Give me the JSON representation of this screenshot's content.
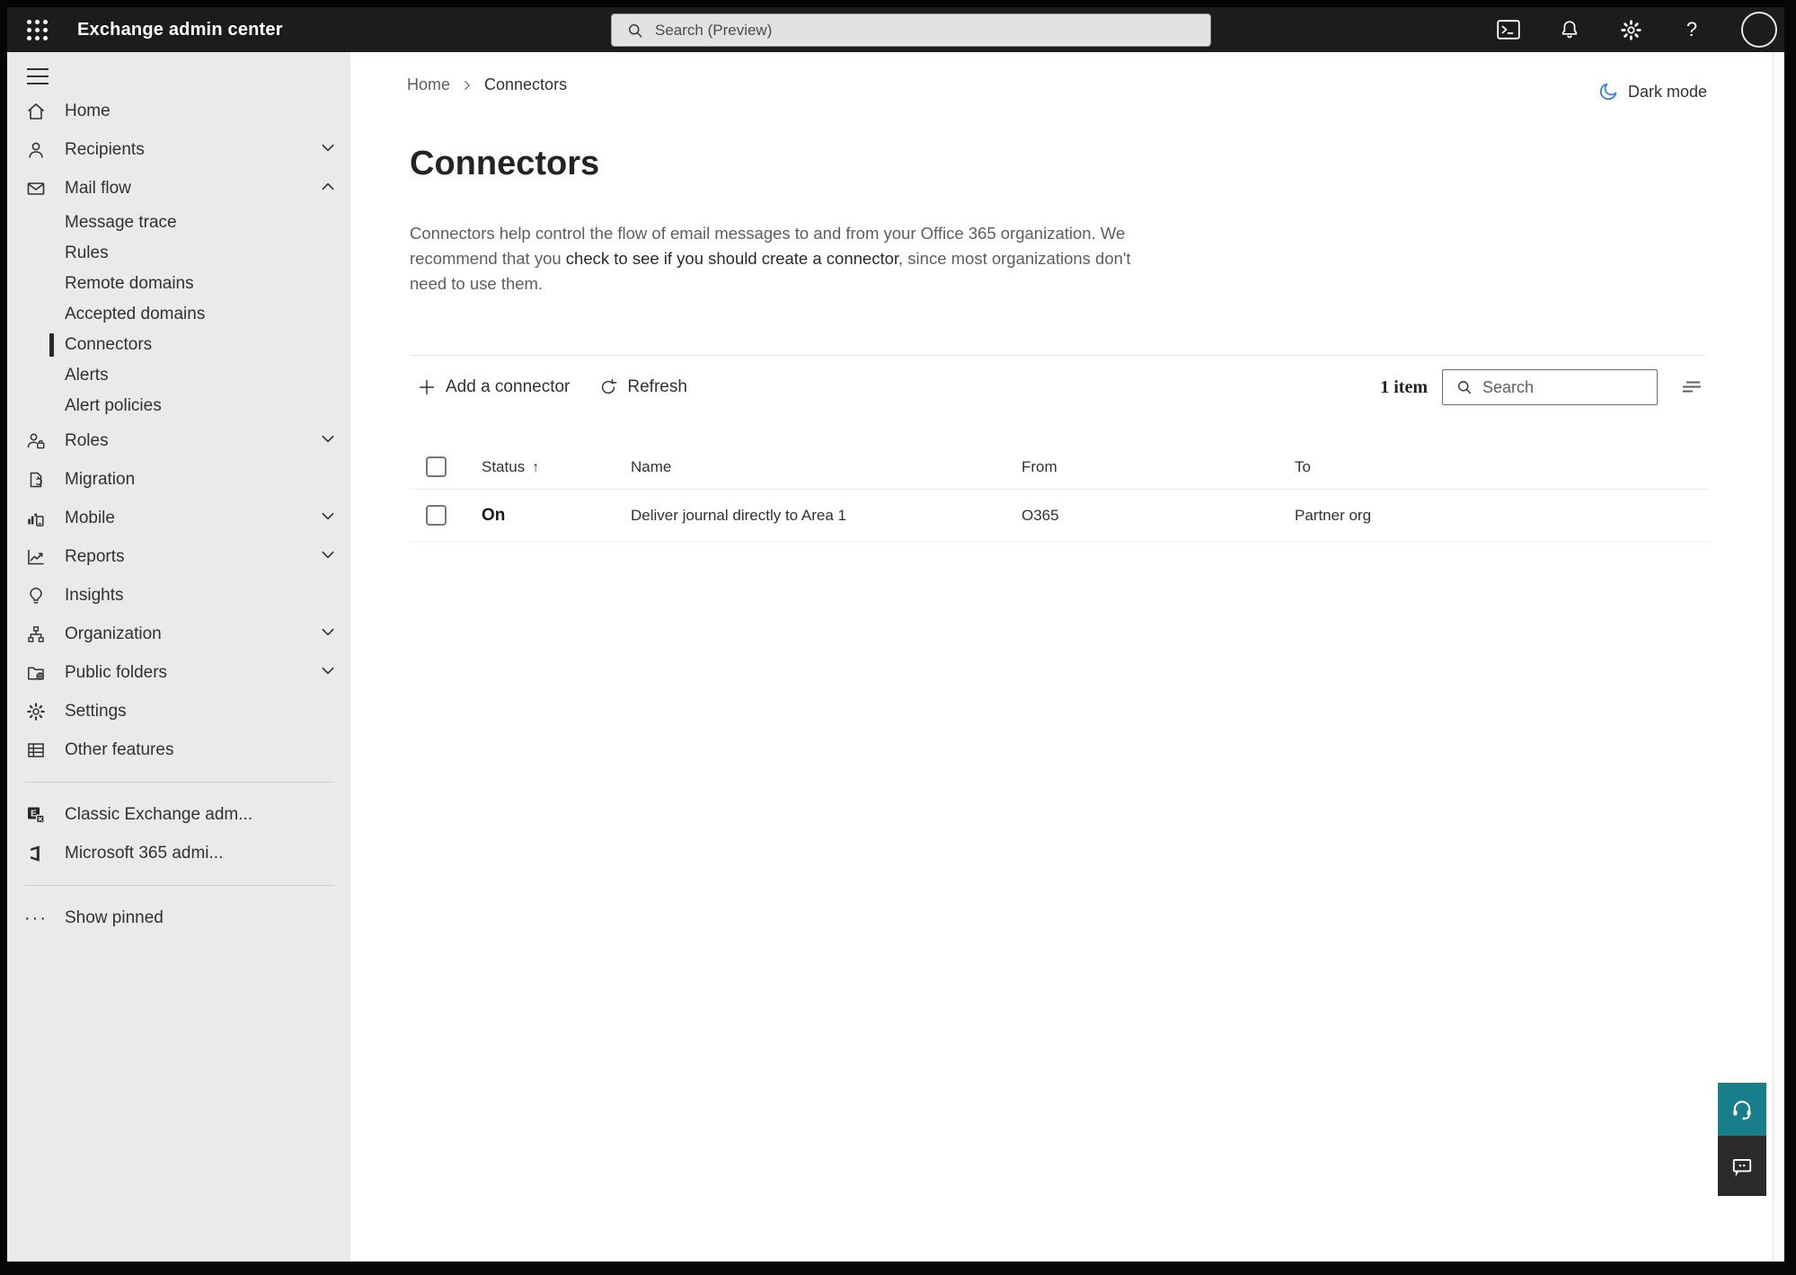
{
  "topbar": {
    "title": "Exchange admin center",
    "search_placeholder": "Search (Preview)"
  },
  "sidebar": {
    "items": [
      {
        "label": "Home"
      },
      {
        "label": "Recipients"
      },
      {
        "label": "Mail flow"
      },
      {
        "label": "Message trace"
      },
      {
        "label": "Rules"
      },
      {
        "label": "Remote domains"
      },
      {
        "label": "Accepted domains"
      },
      {
        "label": "Connectors"
      },
      {
        "label": "Alerts"
      },
      {
        "label": "Alert policies"
      },
      {
        "label": "Roles"
      },
      {
        "label": "Migration"
      },
      {
        "label": "Mobile"
      },
      {
        "label": "Reports"
      },
      {
        "label": "Insights"
      },
      {
        "label": "Organization"
      },
      {
        "label": "Public folders"
      },
      {
        "label": "Settings"
      },
      {
        "label": "Other features"
      },
      {
        "label": "Classic Exchange adm..."
      },
      {
        "label": "Microsoft 365 admi..."
      },
      {
        "label": "Show pinned"
      }
    ]
  },
  "breadcrumb": {
    "home": "Home",
    "current": "Connectors"
  },
  "header": {
    "dark_mode_label": "Dark mode"
  },
  "page": {
    "title": "Connectors",
    "desc_pre": "Connectors help control the flow of email messages to and from your Office 365 organization. We recommend that you ",
    "desc_link": "check to see if you should create a connector",
    "desc_post": ", since most organizations don't need to use them."
  },
  "toolbar": {
    "add_label": "Add a connector",
    "refresh_label": "Refresh",
    "count": "1 item",
    "search_placeholder": "Search"
  },
  "table": {
    "headers": [
      "Status",
      "Name",
      "From",
      "To"
    ],
    "sort_arrow": "↑",
    "rows": [
      {
        "status": "On",
        "name": "Deliver journal directly to Area 1",
        "from": "O365",
        "to": "Partner org"
      }
    ]
  },
  "colors": {
    "topbar_bg": "#1d1c1b",
    "sidebar_bg": "#eaeaea",
    "accent_teal": "#187e8a",
    "feedback_dark": "#2b2a29",
    "moon_blue": "#3a80d2",
    "text_primary": "#323130",
    "text_secondary": "#605e5c"
  }
}
